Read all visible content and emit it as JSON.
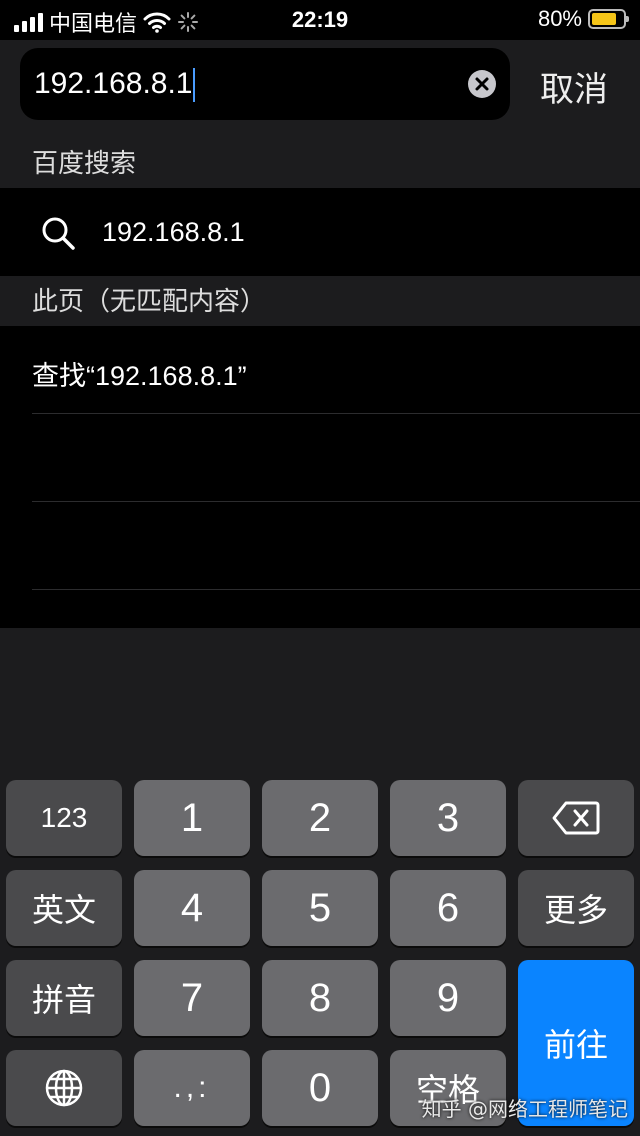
{
  "status_bar": {
    "carrier": "中国电信",
    "time": "22:19",
    "battery": "80%",
    "battery_level": 0.8
  },
  "search": {
    "query": "192.168.8.1",
    "cancel_label": "取消"
  },
  "sections": {
    "baidu": {
      "header": "百度搜索",
      "suggestion": "192.168.8.1"
    },
    "this_page": {
      "header": "此页（无匹配内容）",
      "find_label": "查找“192.168.8.1”"
    }
  },
  "keyboard": {
    "keys": {
      "num_toggle": "123",
      "k1": "1",
      "k2": "2",
      "k3": "3",
      "english": "英文",
      "k4": "4",
      "k5": "5",
      "k6": "6",
      "more": "更多",
      "pinyin": "拼音",
      "k7": "7",
      "k8": "8",
      "k9": "9",
      "go": "前往",
      "punct": ".,:",
      "k0": "0",
      "space": "空格"
    }
  },
  "watermark": "知乎 @网络工程师笔记",
  "colors": {
    "accent": "#0a84ff",
    "battery": "#f5c518",
    "caret": "#4a9cff"
  }
}
